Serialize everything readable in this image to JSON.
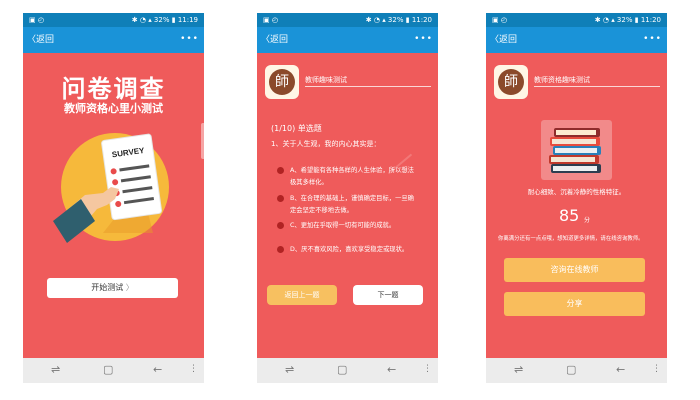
{
  "status": {
    "left_icons": "▣ ◴",
    "right": "✱ ◔ ▴ 32% ▮"
  },
  "common": {
    "back_label": "返回",
    "more_label": "•••"
  },
  "screens": [
    {
      "time": "11:19",
      "title": "问卷调查",
      "subtitle": "教师资格心里小测试",
      "illustration_label": "SURVEY",
      "start_button": "开始测试",
      "chevron": "〉"
    },
    {
      "time": "11:20",
      "header": "教师趣味测试",
      "avatar_char": "師",
      "question_counter": "(1/10) 单选题",
      "question": "1、关于人生观，我的内心其实是：",
      "options": [
        "A、希望能有各种各样的人生体验，所以想法极其多样化。",
        "B、在合理的基础上，谨慎确定目标，一旦确定会坚定不移地去做。",
        "C、更加在乎取得一切有可能的成就。",
        "D、厌不喜欢风险，喜欢享受稳定或现状。"
      ],
      "prev_button": "返回上一题",
      "next_button": "下一题"
    },
    {
      "time": "11:20",
      "header": "教师资格趣味测试",
      "avatar_char": "師",
      "trait": "耐心细致、沉着冷静的性格特征。",
      "score": "85",
      "score_unit": "分",
      "description": "你离满分还有一点点哦，想知道更多详情，请在线咨询教师。",
      "consult_button": "咨询在线教师",
      "share_button": "分享"
    }
  ],
  "nav": {
    "recent": "⇌",
    "home": "▢",
    "back": "←",
    "menu": "⋮"
  },
  "colors": {
    "page_bg": "#ef5b5b",
    "header_blue": "#1a93d8",
    "status_blue": "#0f7fb8",
    "accent_yellow": "#f9bd5c",
    "dot_red": "#b02323"
  }
}
